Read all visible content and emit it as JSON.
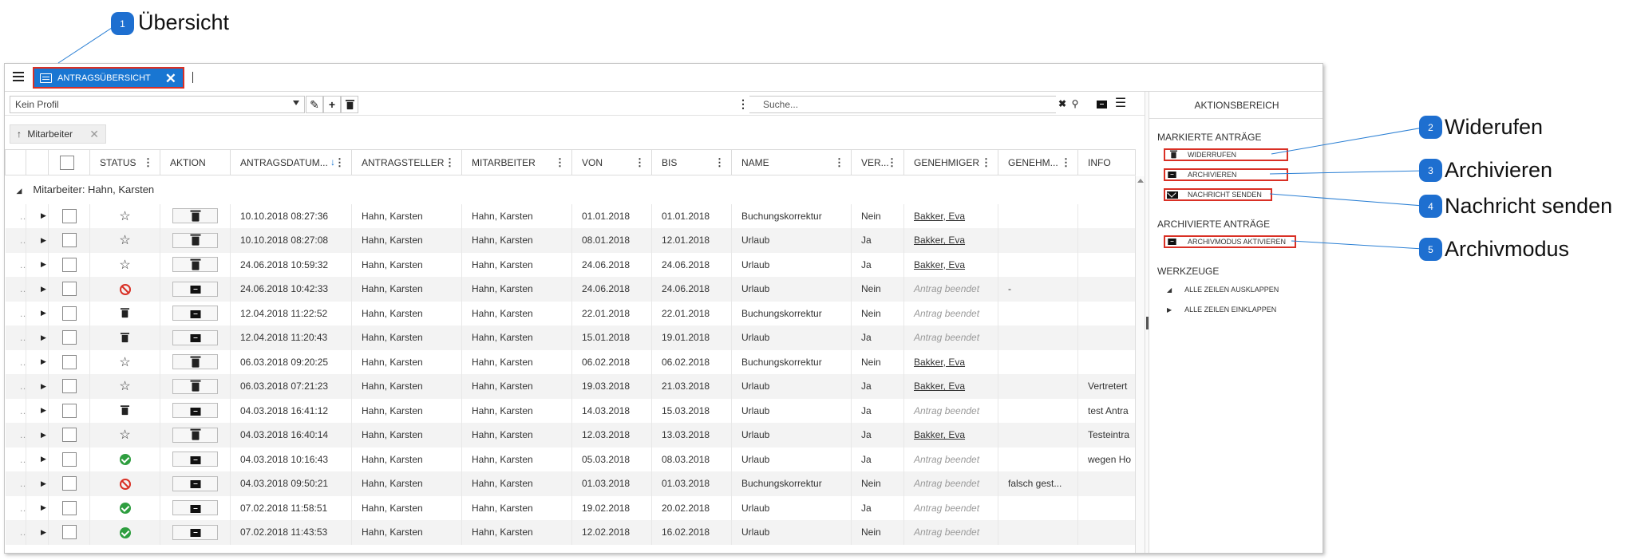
{
  "callouts": [
    {
      "n": "1",
      "label": "Übersicht"
    },
    {
      "n": "2",
      "label": "Widerufen"
    },
    {
      "n": "3",
      "label": "Archivieren"
    },
    {
      "n": "4",
      "label": "Nachricht senden"
    },
    {
      "n": "5",
      "label": "Archivmodus"
    }
  ],
  "tab": {
    "title": "ANTRAGSÜBERSICHT"
  },
  "toolbar": {
    "profile": "Kein Profil",
    "search_placeholder": "Suche..."
  },
  "filter": {
    "chip": "Mitarbeiter"
  },
  "columns": [
    "STATUS",
    "AKTION",
    "ANTRAGSDATUM...",
    "ANTRAGSTELLER",
    "MITARBEITER",
    "VON",
    "BIS",
    "NAME",
    "VER...",
    "GENEHMIGER",
    "GENEHM...",
    "INFO"
  ],
  "group": "Mitarbeiter: Hahn, Karsten",
  "rows": [
    {
      "status": "star",
      "action": "trash",
      "datum": "10.10.2018 08:27:36",
      "steller": "Hahn, Karsten",
      "mitarbeiter": "Hahn, Karsten",
      "von": "01.01.2018",
      "bis": "01.01.2018",
      "name": "Buchungskorrektur",
      "ver": "Nein",
      "genehmiger": "Bakker, Eva",
      "genehm2": "",
      "info": ""
    },
    {
      "status": "star",
      "action": "trash",
      "datum": "10.10.2018 08:27:08",
      "steller": "Hahn, Karsten",
      "mitarbeiter": "Hahn, Karsten",
      "von": "08.01.2018",
      "bis": "12.01.2018",
      "name": "Urlaub",
      "ver": "Ja",
      "genehmiger": "Bakker, Eva",
      "genehm2": "",
      "info": ""
    },
    {
      "status": "star",
      "action": "trash",
      "datum": "24.06.2018 10:59:32",
      "steller": "Hahn, Karsten",
      "mitarbeiter": "Hahn, Karsten",
      "von": "24.06.2018",
      "bis": "24.06.2018",
      "name": "Urlaub",
      "ver": "Ja",
      "genehmiger": "Bakker, Eva",
      "genehm2": "",
      "info": ""
    },
    {
      "status": "forbid",
      "action": "archive",
      "datum": "24.06.2018 10:42:33",
      "steller": "Hahn, Karsten",
      "mitarbeiter": "Hahn, Karsten",
      "von": "24.06.2018",
      "bis": "24.06.2018",
      "name": "Urlaub",
      "ver": "Nein",
      "genehmiger": "Antrag beendet",
      "genehm2": "-",
      "info": ""
    },
    {
      "status": "trash",
      "action": "archive",
      "datum": "12.04.2018 11:22:52",
      "steller": "Hahn, Karsten",
      "mitarbeiter": "Hahn, Karsten",
      "von": "22.01.2018",
      "bis": "22.01.2018",
      "name": "Buchungskorrektur",
      "ver": "Nein",
      "genehmiger": "Antrag beendet",
      "genehm2": "",
      "info": ""
    },
    {
      "status": "trash",
      "action": "archive",
      "datum": "12.04.2018 11:20:43",
      "steller": "Hahn, Karsten",
      "mitarbeiter": "Hahn, Karsten",
      "von": "15.01.2018",
      "bis": "19.01.2018",
      "name": "Urlaub",
      "ver": "Ja",
      "genehmiger": "Antrag beendet",
      "genehm2": "",
      "info": ""
    },
    {
      "status": "star",
      "action": "trash",
      "datum": "06.03.2018 09:20:25",
      "steller": "Hahn, Karsten",
      "mitarbeiter": "Hahn, Karsten",
      "von": "06.02.2018",
      "bis": "06.02.2018",
      "name": "Buchungskorrektur",
      "ver": "Nein",
      "genehmiger": "Bakker, Eva",
      "genehm2": "",
      "info": ""
    },
    {
      "status": "star",
      "action": "trash",
      "datum": "06.03.2018 07:21:23",
      "steller": "Hahn, Karsten",
      "mitarbeiter": "Hahn, Karsten",
      "von": "19.03.2018",
      "bis": "21.03.2018",
      "name": "Urlaub",
      "ver": "Ja",
      "genehmiger": "Bakker, Eva",
      "genehm2": "",
      "info": "Vertretert"
    },
    {
      "status": "trash",
      "action": "archive",
      "datum": "04.03.2018 16:41:12",
      "steller": "Hahn, Karsten",
      "mitarbeiter": "Hahn, Karsten",
      "von": "14.03.2018",
      "bis": "15.03.2018",
      "name": "Urlaub",
      "ver": "Ja",
      "genehmiger": "Antrag beendet",
      "genehm2": "",
      "info": "test Antra"
    },
    {
      "status": "star",
      "action": "trash",
      "datum": "04.03.2018 16:40:14",
      "steller": "Hahn, Karsten",
      "mitarbeiter": "Hahn, Karsten",
      "von": "12.03.2018",
      "bis": "13.03.2018",
      "name": "Urlaub",
      "ver": "Ja",
      "genehmiger": "Bakker, Eva",
      "genehm2": "",
      "info": "Testeintra"
    },
    {
      "status": "check",
      "action": "archive",
      "datum": "04.03.2018 10:16:43",
      "steller": "Hahn, Karsten",
      "mitarbeiter": "Hahn, Karsten",
      "von": "05.03.2018",
      "bis": "08.03.2018",
      "name": "Urlaub",
      "ver": "Ja",
      "genehmiger": "Antrag beendet",
      "genehm2": "",
      "info": "wegen Ho"
    },
    {
      "status": "forbid",
      "action": "archive",
      "datum": "04.03.2018 09:50:21",
      "steller": "Hahn, Karsten",
      "mitarbeiter": "Hahn, Karsten",
      "von": "01.03.2018",
      "bis": "01.03.2018",
      "name": "Buchungskorrektur",
      "ver": "Nein",
      "genehmiger": "Antrag beendet",
      "genehm2": "falsch gest...",
      "info": ""
    },
    {
      "status": "check",
      "action": "archive",
      "datum": "07.02.2018 11:58:51",
      "steller": "Hahn, Karsten",
      "mitarbeiter": "Hahn, Karsten",
      "von": "19.02.2018",
      "bis": "20.02.2018",
      "name": "Urlaub",
      "ver": "Ja",
      "genehmiger": "Antrag beendet",
      "genehm2": "",
      "info": ""
    },
    {
      "status": "check",
      "action": "archive",
      "datum": "07.02.2018 11:43:53",
      "steller": "Hahn, Karsten",
      "mitarbeiter": "Hahn, Karsten",
      "von": "12.02.2018",
      "bis": "16.02.2018",
      "name": "Urlaub",
      "ver": "Nein",
      "genehmiger": "Antrag beendet",
      "genehm2": "",
      "info": ""
    }
  ],
  "aside": {
    "title": "AKTIONSBEREICH",
    "marked_title": "MARKIERTE ANTRÄGE",
    "widerrufen": "WIDERRUFEN",
    "archivieren": "ARCHIVIEREN",
    "nachricht": "NACHRICHT SENDEN",
    "archived_title": "ARCHIVIERTE ANTRÄGE",
    "archivmodus": "ARCHIVMODUS AKTIVIEREN",
    "tools_title": "WERKZEUGE",
    "expand": "ALLE ZEILEN AUSKLAPPEN",
    "collapse": "ALLE ZEILEN EINKLAPPEN"
  },
  "colors": {
    "accent": "#1976d2",
    "highlight": "#d93025",
    "ok": "#2e9e3f"
  }
}
